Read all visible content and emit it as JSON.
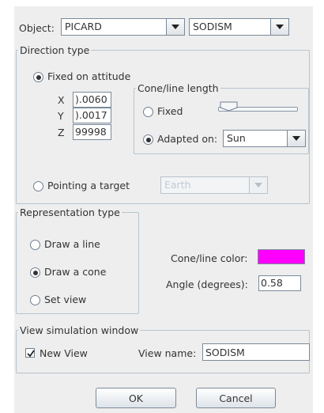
{
  "header": {
    "object_label": "Object:",
    "object_value": "PICARD",
    "instrument_value": "SODISM"
  },
  "direction": {
    "legend": "Direction type",
    "fixed_attitude_label": "Fixed on attitude",
    "x_label": "X",
    "x_value": ").0060",
    "y_label": "Y",
    "y_value": ").0017",
    "z_label": "Z",
    "z_value": "99998",
    "cone_legend": "Cone/line length",
    "fixed_label": "Fixed",
    "adapted_label": "Adapted on:",
    "adapted_value": "Sun",
    "pointing_label": "Pointing a target",
    "pointing_value": "Earth"
  },
  "representation": {
    "legend": "Representation type",
    "draw_line_label": "Draw a line",
    "draw_cone_label": "Draw a cone",
    "set_view_label": "Set view",
    "color_label": "Cone/line color:",
    "color_value": "#ff00ff",
    "angle_label": "Angle (degrees):",
    "angle_value": "0.58"
  },
  "view": {
    "legend": "View simulation window",
    "new_view_label": "New View",
    "view_name_label": "View name:",
    "view_name_value": "SODISM"
  },
  "buttons": {
    "ok_label": "OK",
    "cancel_label": "Cancel"
  }
}
